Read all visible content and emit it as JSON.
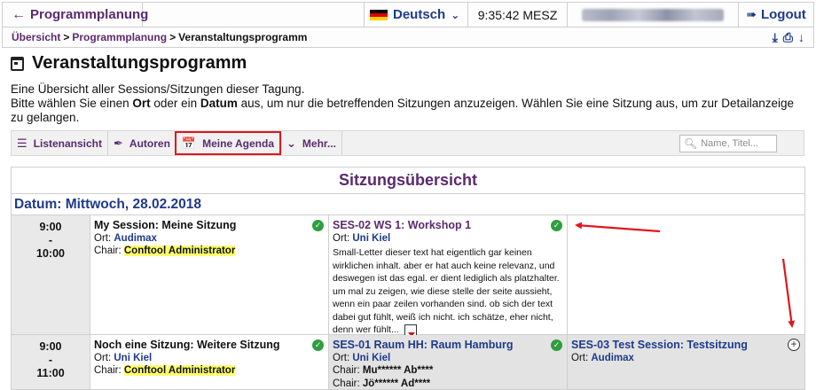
{
  "topbar": {
    "back_label": "Programmplanung",
    "back_arrow": "←",
    "language": "Deutsch",
    "time": "9:35:42 MESZ",
    "logout_label": "Logout",
    "flag_colors": [
      "#000000",
      "#dd0000",
      "#ffce00"
    ]
  },
  "breadcrumb": {
    "items": [
      "Übersicht",
      "Programmplanung"
    ],
    "separator": ">",
    "current": "Veranstaltungsprogramm"
  },
  "page": {
    "title": "Veranstaltungsprogramm",
    "intro_line1": "Eine Übersicht aller Sessions/Sitzungen dieser Tagung.",
    "intro_line2_a": "Bitte wählen Sie einen ",
    "intro_ort": "Ort",
    "intro_line2_b": " oder ein ",
    "intro_datum": "Datum",
    "intro_line2_c": " aus, um nur die betreffenden Sitzungen anzuzeigen. Wählen Sie eine Sitzung aus, um zur Detailanzeige zu gelangen."
  },
  "toolbar": {
    "list_view": "Listenansicht",
    "authors": "Autoren",
    "my_agenda": "Meine Agenda",
    "more": "Mehr...",
    "search_placeholder": "Name, Titel..."
  },
  "overview": {
    "title": "Sitzungsübersicht",
    "date_label": "Datum: Mittwoch, 28.02.2018",
    "rows": [
      {
        "time_start": "9:00",
        "time_dash": "-",
        "time_end": "10:00",
        "sessions": [
          {
            "title": "My Session: Meine Sitzung",
            "ort_label": "Ort: ",
            "ort": "Audimax",
            "chair_label": "Chair: ",
            "chair": "Conftool Administrator"
          },
          {
            "title": "SES-02 WS 1: Workshop 1",
            "ort_label": "Ort: ",
            "ort": "Uni Kiel",
            "abstract": "Small-Letter dieser text hat eigentlich gar keinen wirklichen inhalt. aber er hat auch keine relevanz, und deswegen ist das egal. er dient lediglich als platzhalter. um mal zu zeigen, wie diese stelle der seite aussieht, wenn ein paar zeilen vorhanden sind. ob sich der text dabei gut fühlt, weiß ich nicht. ich schätze, eher nicht, denn wer fühlt..."
          }
        ]
      },
      {
        "time_start": "9:00",
        "time_dash": "-",
        "time_end": "11:00",
        "sessions": [
          {
            "title": "Noch eine Sitzung: Weitere Sitzung",
            "ort_label": "Ort: ",
            "ort": "Uni Kiel",
            "chair_label": "Chair: ",
            "chair": "Conftool Administrator"
          },
          {
            "title": "SES-01 Raum HH: Raum Hamburg",
            "ort_label": "Ort: ",
            "ort": "Uni Kiel",
            "chair_label": "Chair: ",
            "chair1": "Mu****** Ab****",
            "chair2": "Jö****** Ad****"
          },
          {
            "title": "SES-03 Test Session: Testsitzung",
            "ort_label": "Ort: ",
            "ort": "Audimax"
          }
        ]
      }
    ]
  },
  "colors": {
    "purple": "#5b2a6e",
    "blue": "#1f3a8a",
    "highlight": "#ffff6e",
    "check_green": "#2e9e3e",
    "annotation_red": "#e0161b"
  }
}
